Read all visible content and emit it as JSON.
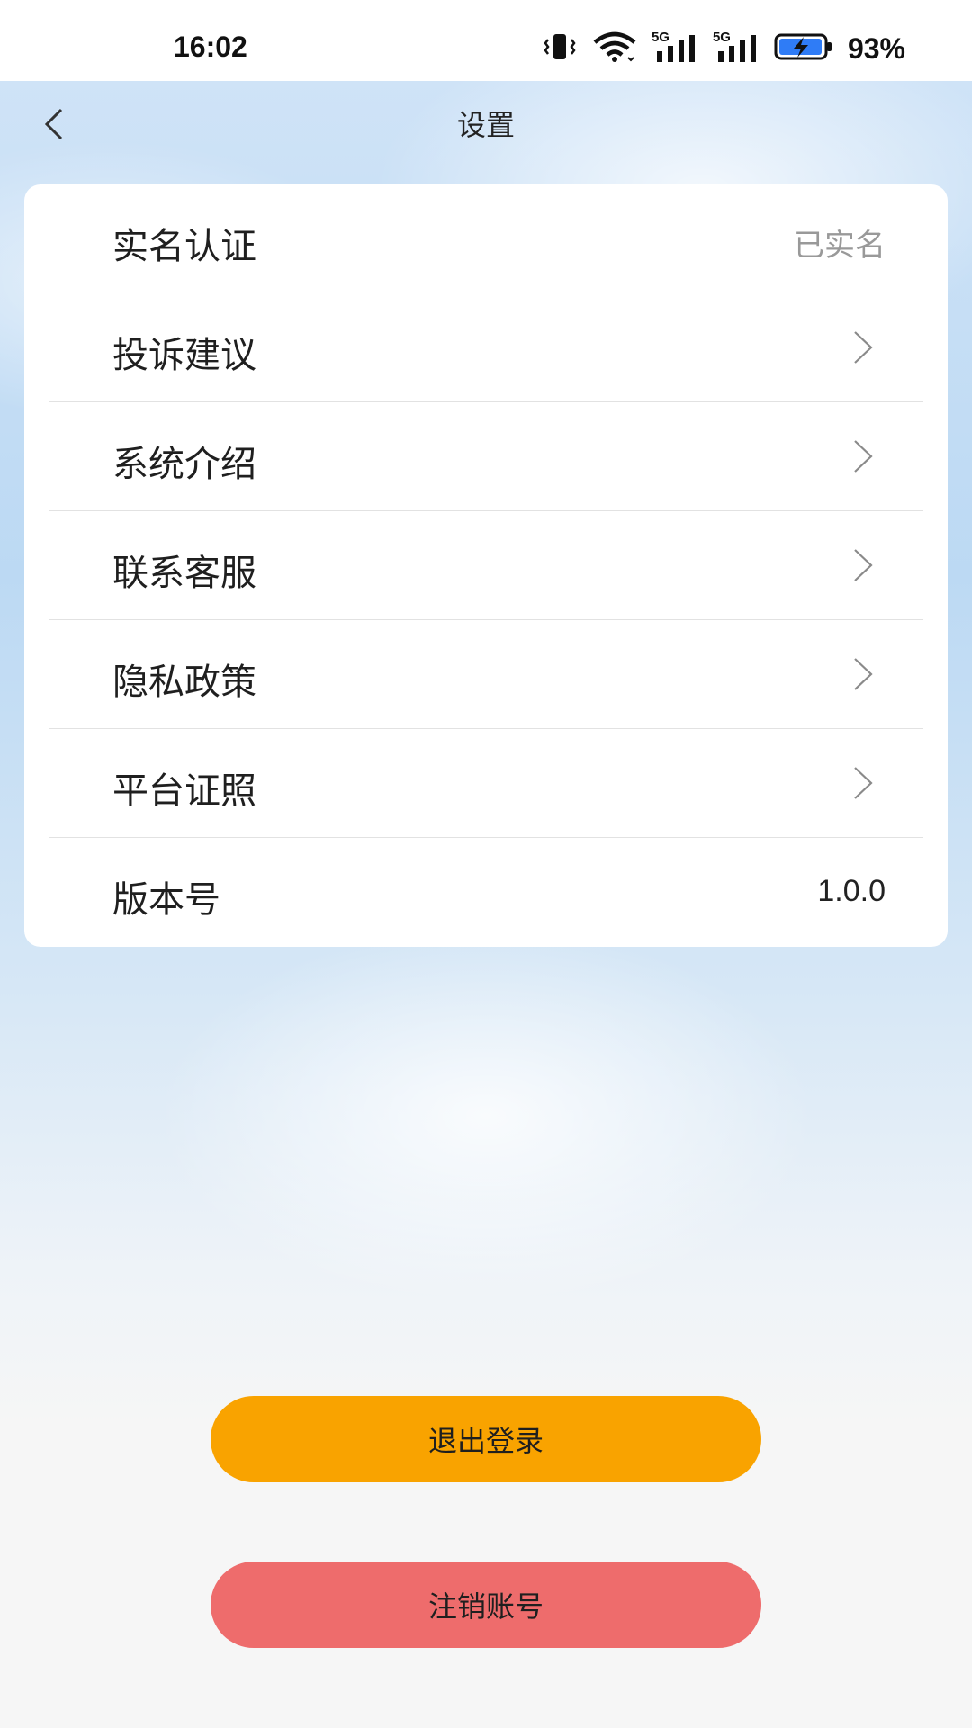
{
  "status_bar": {
    "time": "16:02",
    "battery_percent": "93%",
    "icons": [
      "vibrate-icon",
      "wifi-icon",
      "signal-5g-icon",
      "signal-5g-icon",
      "battery-charging-icon"
    ],
    "signal_label": "5G"
  },
  "navbar": {
    "title": "设置",
    "back_icon": "chevron-left-icon"
  },
  "settings": {
    "items": [
      {
        "label": "实名认证",
        "value": "已实名"
      },
      {
        "label": "投诉建议",
        "icon": "chevron-right-icon"
      },
      {
        "label": "系统介绍",
        "icon": "chevron-right-icon"
      },
      {
        "label": "联系客服",
        "icon": "chevron-right-icon"
      },
      {
        "label": "隐私政策",
        "icon": "chevron-right-icon"
      },
      {
        "label": "平台证照",
        "icon": "chevron-right-icon"
      },
      {
        "label": "版本号",
        "value": "1.0.0"
      }
    ]
  },
  "actions": {
    "logout_label": "退出登录",
    "cancel_account_label": "注销账号"
  },
  "colors": {
    "logout_button": "#f9a300",
    "cancel_button": "#ee6c6c",
    "battery_fill": "#2f7cf6"
  }
}
